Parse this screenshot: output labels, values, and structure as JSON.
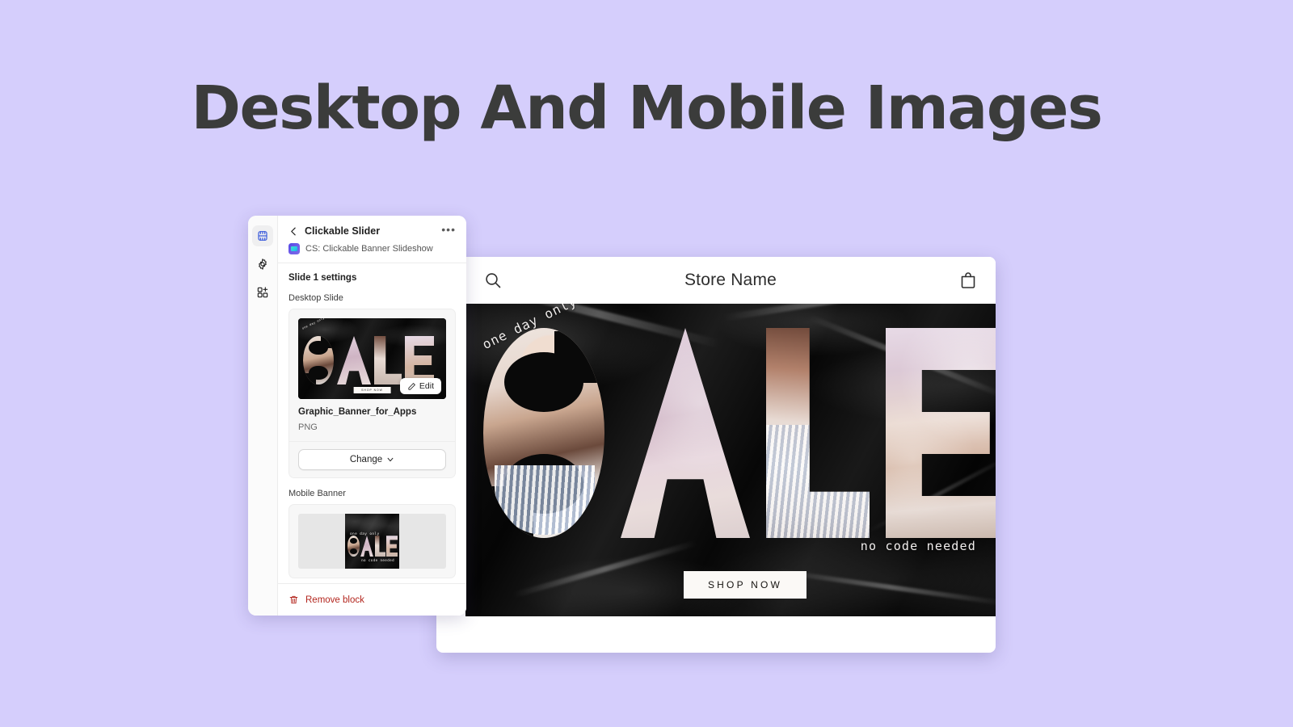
{
  "page": {
    "title": "Desktop And Mobile Images",
    "background_color": "#d5cefc",
    "title_color": "#3b3c3b"
  },
  "settings_panel": {
    "rail": [
      {
        "name": "sections-icon",
        "label": "Sections",
        "active": true
      },
      {
        "name": "settings-gear-icon",
        "label": "Settings",
        "active": false
      },
      {
        "name": "add-app-block-icon",
        "label": "Apps",
        "active": false
      }
    ],
    "header": {
      "back_label": "Back",
      "title": "Clickable Slider",
      "more_label": "•••",
      "app_name": "CS: Clickable Banner Slideshow"
    },
    "section_title": "Slide 1 settings",
    "desktop": {
      "label": "Desktop Slide",
      "edit_label": "Edit",
      "file_name": "Graphic_Banner_for_Apps",
      "file_type": "PNG",
      "change_label": "Change"
    },
    "mobile": {
      "label": "Mobile Banner"
    },
    "footer": {
      "remove_label": "Remove block",
      "remove_color": "#b3261e"
    }
  },
  "store_preview": {
    "header": {
      "search_icon": "search-icon",
      "store_name": "Store Name",
      "cart_icon": "shopping-bag-icon"
    },
    "banner": {
      "kicker": "one day only",
      "wordmark": "SALE",
      "letters": [
        "S",
        "A",
        "L",
        "E"
      ],
      "footnote": "no code needed",
      "cta_label": "SHOP NOW",
      "next_label": "›"
    }
  }
}
